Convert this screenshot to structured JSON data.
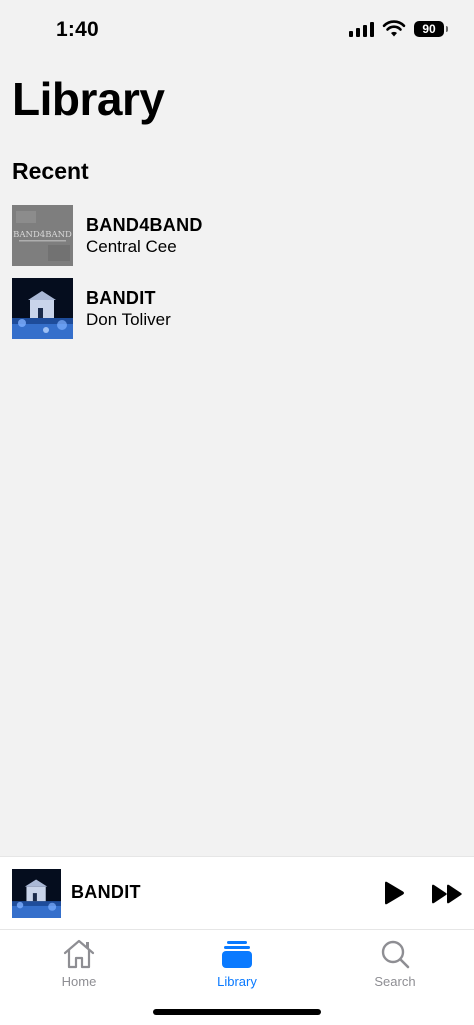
{
  "status_bar": {
    "time": "1:40",
    "battery": "90"
  },
  "page": {
    "title": "Library",
    "section_title": "Recent"
  },
  "recent": [
    {
      "title": "BAND4BAND",
      "artist": "Central Cee",
      "cover_text": "BAND4BAND"
    },
    {
      "title": "BANDIT",
      "artist": "Don Toliver"
    }
  ],
  "mini_player": {
    "title": "BANDIT",
    "play_icon": "play-icon",
    "next_icon": "fast-forward-icon"
  },
  "tabs": [
    {
      "label": "Home",
      "icon": "home-icon",
      "active": false
    },
    {
      "label": "Library",
      "icon": "library-icon",
      "active": true
    },
    {
      "label": "Search",
      "icon": "search-icon",
      "active": false
    }
  ],
  "colors": {
    "background": "#f2f2f2",
    "accent": "#0a7aff",
    "inactive": "#8e8e93"
  }
}
